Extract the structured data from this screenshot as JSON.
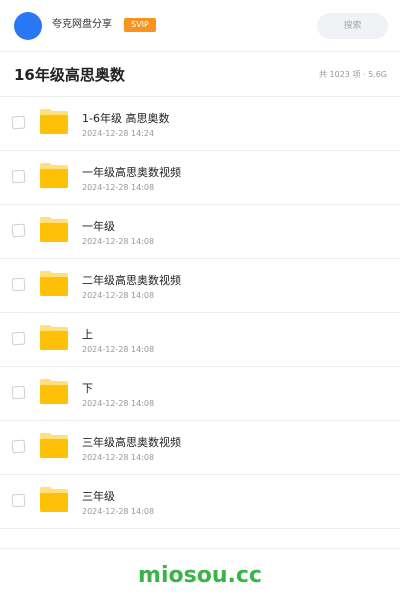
{
  "header": {
    "app_name": "夸克网盘分享",
    "badge": "SVIP",
    "search_placeholder": "搜索",
    "avatar_color": "#2a77f6",
    "badge_color": "#f7931e"
  },
  "folder": {
    "title": "16年级高思奥数",
    "stats": "共 1023 项 · 5.6G"
  },
  "files": [
    {
      "name": "1-6年级 高思奥数",
      "date": "2024-12-28 14:24",
      "icon": "folder-icon"
    },
    {
      "name": "一年级高思奥数视频",
      "date": "2024-12-28 14:08",
      "icon": "folder-icon"
    },
    {
      "name": "一年级",
      "date": "2024-12-28 14:08",
      "icon": "folder-icon"
    },
    {
      "name": "二年级高思奥数视频",
      "date": "2024-12-28 14:08",
      "icon": "folder-icon"
    },
    {
      "name": "上",
      "date": "2024-12-28 14:08",
      "icon": "folder-icon"
    },
    {
      "name": "下",
      "date": "2024-12-28 14:08",
      "icon": "folder-icon"
    },
    {
      "name": "三年级高思奥数视频",
      "date": "2024-12-28 14:08",
      "icon": "folder-icon"
    },
    {
      "name": "三年级",
      "date": "2024-12-28 14:08",
      "icon": "folder-icon"
    }
  ],
  "footer": {
    "watermark": "miosou.cc",
    "watermark_color": "#3cb34a"
  },
  "colors": {
    "folder_yellow": "#ffc107",
    "folder_light": "#ffe07a"
  }
}
